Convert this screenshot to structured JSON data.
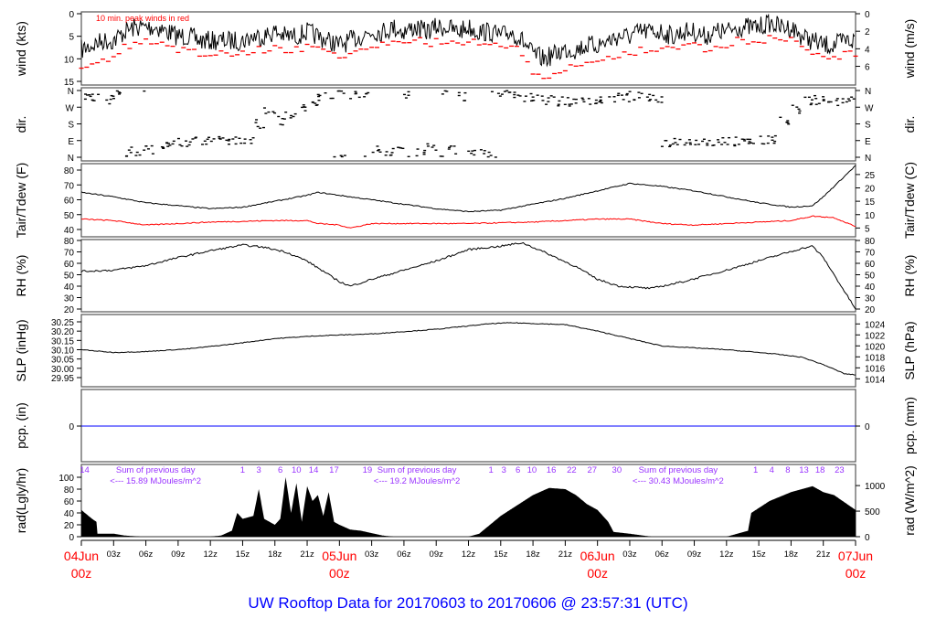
{
  "chart_data": {
    "type": "line",
    "title": "UW Rooftop Data for 20170603  to  20170606 @ 23:57:31  (UTC)",
    "x_unit": "hours since 04Jun 00z",
    "xlim": [
      0,
      72
    ],
    "x_ticks": [
      {
        "h": 0,
        "label": "04Jun",
        "sub": "00z",
        "major": true
      },
      {
        "h": 3,
        "label": "03z"
      },
      {
        "h": 6,
        "label": "06z"
      },
      {
        "h": 9,
        "label": "09z"
      },
      {
        "h": 12,
        "label": "12z"
      },
      {
        "h": 15,
        "label": "15z"
      },
      {
        "h": 18,
        "label": "18z"
      },
      {
        "h": 21,
        "label": "21z"
      },
      {
        "h": 24,
        "label": "05Jun",
        "sub": "00z",
        "major": true
      },
      {
        "h": 27,
        "label": "03z"
      },
      {
        "h": 30,
        "label": "06z"
      },
      {
        "h": 33,
        "label": "09z"
      },
      {
        "h": 36,
        "label": "12z"
      },
      {
        "h": 39,
        "label": "15z"
      },
      {
        "h": 42,
        "label": "18z"
      },
      {
        "h": 45,
        "label": "21z"
      },
      {
        "h": 48,
        "label": "06Jun",
        "sub": "00z",
        "major": true
      },
      {
        "h": 51,
        "label": "03z"
      },
      {
        "h": 54,
        "label": "06z"
      },
      {
        "h": 57,
        "label": "09z"
      },
      {
        "h": 60,
        "label": "12z"
      },
      {
        "h": 63,
        "label": "15z"
      },
      {
        "h": 66,
        "label": "18z"
      },
      {
        "h": 69,
        "label": "21z"
      },
      {
        "h": 72,
        "label": "07Jun",
        "sub": "00z",
        "major": true
      }
    ],
    "panels": [
      {
        "id": "wind",
        "ylabel": "wind (kts)",
        "ylabel_right": "wind (m/s)",
        "ylim": [
          0,
          15
        ],
        "left_ticks": [
          0,
          5,
          10,
          15
        ],
        "right_ticks": [
          0,
          2,
          4,
          6
        ],
        "right_factor": 1.9438,
        "annotation": "10 min. peak winds in red",
        "series": [
          {
            "name": "wind",
            "color": "#000000",
            "x_hourly": true,
            "values": [
              8,
              7,
              6,
              6,
              4,
              3,
              3,
              3,
              4,
              5,
              5,
              6,
              6,
              6,
              6,
              6,
              5,
              5,
              4,
              5,
              5,
              4,
              5,
              6,
              7,
              6,
              5,
              4,
              4,
              3,
              4,
              3,
              4,
              3,
              3,
              4,
              3,
              4,
              4,
              5,
              4,
              6,
              9,
              10,
              9,
              8,
              8,
              7,
              7,
              6,
              5,
              5,
              4,
              4,
              4,
              5,
              4,
              4,
              5,
              4,
              4,
              3,
              3,
              3,
              2,
              3,
              3,
              5,
              6,
              7,
              7,
              6,
              6
            ]
          },
          {
            "name": "peak",
            "color": "#ff0000",
            "x_hourly": true,
            "style": "dash",
            "values": [
              12,
              11,
              10,
              9,
              7,
              6,
              6,
              6,
              7,
              8,
              8,
              9,
              9,
              9,
              9,
              9,
              8,
              8,
              7,
              8,
              8,
              7,
              8,
              9,
              10,
              9,
              8,
              7,
              7,
              6,
              7,
              6,
              7,
              6,
              6,
              7,
              6,
              7,
              7,
              8,
              7,
              10,
              14,
              14,
              13,
              12,
              12,
              11,
              11,
              10,
              9,
              9,
              8,
              8,
              7,
              8,
              7,
              7,
              8,
              7,
              7,
              6,
              6,
              6,
              5,
              6,
              6,
              8,
              9,
              10,
              10,
              9,
              9
            ]
          }
        ]
      },
      {
        "id": "dir",
        "ylabel": "dir.",
        "ylabel_right": "dir.",
        "ylim": [
          0,
          360
        ],
        "left_tick_labels": [
          {
            "v": 0,
            "t": "N"
          },
          {
            "v": 90,
            "t": "E"
          },
          {
            "v": 180,
            "t": "S"
          },
          {
            "v": 270,
            "t": "W"
          },
          {
            "v": 360,
            "t": "N"
          }
        ],
        "series": [
          {
            "name": "direction",
            "color": "#000000",
            "x_hourly": true,
            "style": "dots",
            "values": [
              320,
              330,
              310,
              340,
              30,
              20,
              40,
              60,
              70,
              80,
              85,
              90,
              90,
              85,
              90,
              100,
              180,
              250,
              200,
              220,
              260,
              300,
              330,
              340,
              345,
              330,
              350,
              40,
              30,
              50,
              340,
              20,
              60,
              350,
              40,
              330,
              30,
              20,
              350,
              340,
              330,
              320,
              330,
              310,
              300,
              300,
              300,
              310,
              310,
              320,
              320,
              330,
              320,
              310,
              80,
              85,
              90,
              85,
              80,
              90,
              85,
              80,
              85,
              90,
              100,
              200,
              260,
              300,
              310,
              310,
              300,
              310,
              300
            ]
          }
        ]
      },
      {
        "id": "temp",
        "ylabel": "Tair/Tdew (F)",
        "ylabel_right": "Tair/Tdew (C)",
        "ylim": [
          40,
          80
        ],
        "left_ticks": [
          40,
          50,
          60,
          70,
          80
        ],
        "right_ticks": [
          5,
          10,
          15,
          20,
          25
        ],
        "right_conv": "C",
        "series": [
          {
            "name": "Tair",
            "color": "#000000",
            "x": [
              0,
              3,
              6,
              9,
              12,
              15,
              18,
              21,
              22,
              24,
              27,
              30,
              33,
              36,
              39,
              42,
              45,
              48,
              51,
              54,
              57,
              60,
              63,
              66,
              68,
              69,
              72
            ],
            "y": [
              65,
              62,
              58,
              56,
              54,
              55,
              59,
              63,
              65,
              63,
              60,
              57,
              54,
              52,
              53,
              57,
              61,
              66,
              71,
              69,
              66,
              62,
              58,
              55,
              56,
              62,
              83
            ]
          },
          {
            "name": "Tdew",
            "color": "#ff0000",
            "x": [
              0,
              3,
              6,
              9,
              12,
              18,
              21,
              22,
              24,
              25,
              27,
              36,
              42,
              48,
              51,
              54,
              57,
              60,
              66,
              68,
              70,
              71,
              72
            ],
            "y": [
              47,
              46,
              43,
              44,
              45,
              46,
              46,
              44,
              43,
              41,
              44,
              44,
              45,
              47,
              47,
              44,
              43,
              44,
              46,
              49,
              48,
              45,
              42
            ]
          }
        ]
      },
      {
        "id": "rh",
        "ylabel": "RH (%)",
        "ylabel_right": "RH (%)",
        "ylim": [
          20,
          80
        ],
        "left_ticks": [
          20,
          30,
          40,
          50,
          60,
          70,
          80
        ],
        "right_ticks": [
          20,
          30,
          40,
          50,
          60,
          70,
          80
        ],
        "series": [
          {
            "name": "RH",
            "color": "#000000",
            "x": [
              0,
              3,
              6,
              9,
              12,
              15,
              17,
              19,
              21,
              23,
              24,
              25,
              27,
              30,
              33,
              36,
              39,
              41,
              43,
              46,
              48,
              50,
              53,
              56,
              60,
              64,
              67,
              68,
              69,
              72
            ],
            "y": [
              53,
              54,
              58,
              65,
              71,
              76,
              74,
              70,
              62,
              50,
              44,
              40,
              46,
              54,
              62,
              72,
              75,
              78,
              70,
              57,
              46,
              40,
              38,
              44,
              54,
              65,
              73,
              75,
              65,
              20
            ]
          }
        ]
      },
      {
        "id": "slp",
        "ylabel": "SLP (inHg)",
        "ylabel_right": "SLP (hPa)",
        "ylim": [
          29.95,
          30.25
        ],
        "left_ticks": [
          29.95,
          30.0,
          30.05,
          30.1,
          30.15,
          30.2,
          30.25
        ],
        "right_ticks": [
          1014,
          1016,
          1018,
          1020,
          1022,
          1024
        ],
        "right_conv": "hPa",
        "series": [
          {
            "name": "SLP",
            "color": "#000000",
            "x": [
              0,
              3,
              6,
              10,
              14,
              18,
              22,
              27,
              33,
              38,
              40,
              45,
              48,
              51,
              54,
              57,
              60,
              64,
              67,
              69,
              71,
              72
            ],
            "y": [
              30.1,
              30.085,
              30.09,
              30.105,
              30.13,
              30.16,
              30.175,
              30.185,
              30.21,
              30.24,
              30.245,
              30.235,
              30.2,
              30.16,
              30.12,
              30.11,
              30.1,
              30.08,
              30.06,
              30.02,
              29.97,
              29.965
            ]
          }
        ]
      },
      {
        "id": "pcp",
        "ylabel": "pcp. (in)",
        "ylabel_right": "pcp. (mm)",
        "ylim": [
          -1,
          1
        ],
        "left_ticks": [
          0
        ],
        "right_ticks": [
          0
        ],
        "series": [
          {
            "name": "precip",
            "color": "#0000ff",
            "x": [
              0,
              72
            ],
            "y": [
              0,
              0
            ]
          }
        ]
      },
      {
        "id": "rad",
        "ylabel": "rad(Lgly/hr)",
        "ylabel_right": "rad (W/m^2)",
        "ylim": [
          0,
          100
        ],
        "left_ticks": [
          0,
          20,
          40,
          60,
          80,
          100
        ],
        "right_ticks": [
          0,
          500,
          1000
        ],
        "right_factor": 0.086,
        "series": [
          {
            "name": "radiation",
            "color": "#000000",
            "style": "area",
            "x": [
              0,
              1,
              1.4,
              1.5,
              2,
              3,
              4,
              5.5,
              12,
              13,
              14,
              14.5,
              15,
              16,
              16.5,
              17,
              18,
              18.5,
              19,
              19.5,
              20,
              20.5,
              21,
              21.5,
              22,
              22.5,
              23,
              23.5,
              24,
              25,
              26,
              27,
              28,
              29,
              36,
              37,
              39,
              42,
              43.5,
              45,
              46,
              47,
              48,
              49,
              49.5,
              51,
              53,
              60,
              62,
              62.3,
              64,
              66,
              67,
              68,
              69,
              70,
              72
            ],
            "y": [
              45,
              30,
              25,
              5,
              5,
              5,
              2,
              0,
              0,
              2,
              10,
              40,
              30,
              35,
              80,
              30,
              20,
              30,
              100,
              40,
              90,
              25,
              85,
              60,
              70,
              35,
              75,
              25,
              20,
              12,
              10,
              6,
              2,
              0,
              0,
              5,
              35,
              70,
              82,
              80,
              70,
              55,
              45,
              25,
              8,
              5,
              0,
              0,
              10,
              40,
              60,
              75,
              80,
              85,
              75,
              70,
              45
            ]
          }
        ],
        "hour_marks": [
          {
            "h": 0.3,
            "t": "14"
          },
          {
            "h": 15,
            "t": "1"
          },
          {
            "h": 16.5,
            "t": "3"
          },
          {
            "h": 18.5,
            "t": "6"
          },
          {
            "h": 20,
            "t": "10"
          },
          {
            "h": 21.6,
            "t": "14"
          },
          {
            "h": 23.5,
            "t": "17"
          },
          {
            "h": 26.6,
            "t": "19"
          },
          {
            "h": 38.1,
            "t": "1"
          },
          {
            "h": 39.3,
            "t": "3"
          },
          {
            "h": 40.6,
            "t": "6"
          },
          {
            "h": 41.9,
            "t": "10"
          },
          {
            "h": 43.7,
            "t": "16"
          },
          {
            "h": 45.6,
            "t": "22"
          },
          {
            "h": 47.5,
            "t": "27"
          },
          {
            "h": 49.8,
            "t": "30"
          },
          {
            "h": 62.7,
            "t": "1"
          },
          {
            "h": 64.2,
            "t": "4"
          },
          {
            "h": 65.7,
            "t": "8"
          },
          {
            "h": 67.2,
            "t": "13"
          },
          {
            "h": 68.7,
            "t": "18"
          },
          {
            "h": 70.5,
            "t": "23"
          }
        ],
        "daily_sums": [
          {
            "h": 6.9,
            "label": "Sum of previous day",
            "value": "<--- 15.89 MJoules/m^2"
          },
          {
            "h": 31.2,
            "label": "Sum of previous day",
            "value": "<--- 19.2 MJoules/m^2"
          },
          {
            "h": 55.5,
            "label": "Sum of previous day",
            "value": "<--- 30.43 MJoules/m^2"
          }
        ]
      }
    ]
  },
  "colors": {
    "date_labels": "#ff0000",
    "annotation": "#9933ff",
    "title": "#0000ff",
    "peak": "#ff0000",
    "dew": "#ff0000",
    "precip": "#0000ff"
  }
}
